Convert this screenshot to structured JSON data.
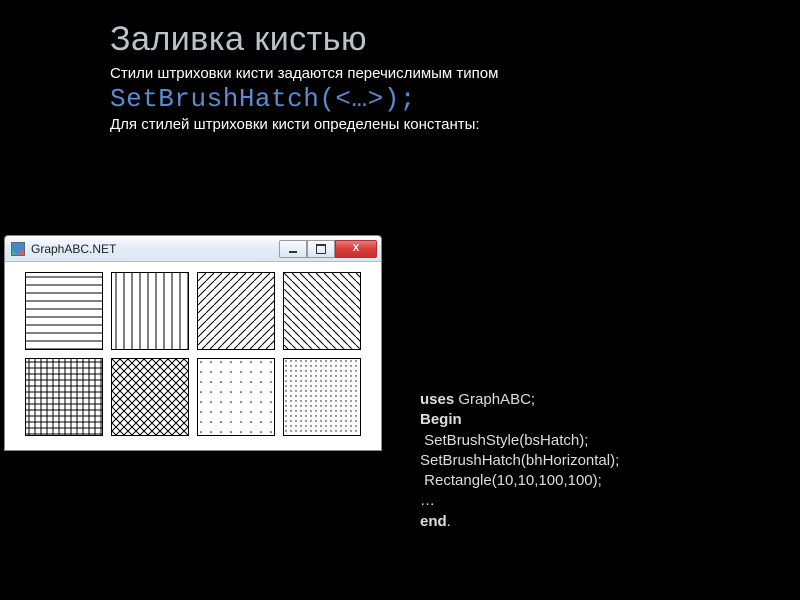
{
  "title": "Заливка кистью",
  "sub1": "Стили штриховки кисти задаются перечислимым типом",
  "codeInline": "SetBrushHatch(<…>);",
  "sub2": "Для стилей штриховки кисти определены константы:",
  "window": {
    "title": "GraphABC.NET",
    "buttons": {
      "min": "–",
      "max": "",
      "close": "X"
    }
  },
  "code": {
    "l1_kw": "uses",
    "l1_rest": " GraphABC;",
    "l2_kw": "Begin",
    "l3": " SetBrushStyle(bsHatch);",
    "l4": "",
    "l5": "SetBrushHatch(bhHorizontal);",
    "l6": " Rectangle(10,10,100,100);",
    "l7": "…",
    "l8_kw": "end",
    "l8_rest": "."
  }
}
